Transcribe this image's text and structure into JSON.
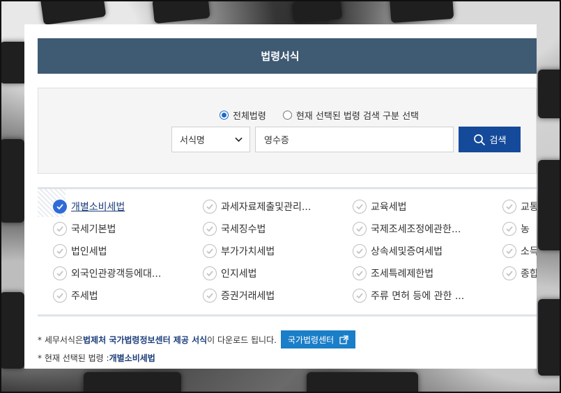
{
  "header": {
    "title": "법령서식"
  },
  "search": {
    "radio_options": [
      "전체법령",
      "현재 선택된 법령 검색 구분 선택"
    ],
    "selected_radio": 0,
    "select_value": "서식명",
    "input_value": "영수증",
    "button_label": "검색"
  },
  "laws": [
    [
      "개별소비세법",
      "과세자료제출및관리...",
      "교육세법",
      "교통"
    ],
    [
      "국세기본법",
      "국세징수법",
      "국제조세조정에관한...",
      "농"
    ],
    [
      "법인세법",
      "부가가치세법",
      "상속세및증여세법",
      "소득"
    ],
    [
      "외국인관광객등에대...",
      "인지세법",
      "조세특례제한법",
      "종합"
    ],
    [
      "주세법",
      "증권거래세법",
      "주류 면허 등에 관한 ..."
    ]
  ],
  "selected_law": "개별소비세법",
  "notes": {
    "line1_prefix": "* 세무서식은 ",
    "line1_bold": "법제처 국가법령정보센터 제공 서식",
    "line1_suffix": "이 다운로드 됩니다.",
    "center_button": "국가법령센터",
    "line2_prefix": "* 현재 선택된 법령 : ",
    "line2_value": "개별소비세법"
  },
  "colors": {
    "title_bar": "#3f5a73",
    "search_button": "#154a9a",
    "center_button": "#1a7ec8",
    "check_selected": "#2f6bd8"
  }
}
